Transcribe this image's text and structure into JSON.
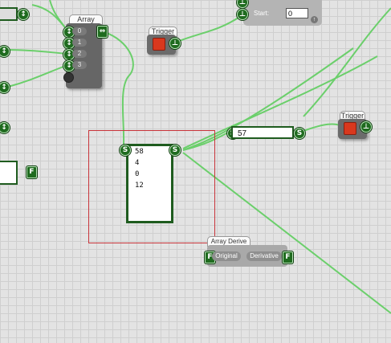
{
  "canvas": {
    "background": "#e3e3e3",
    "wire_color": "#6bcf6b",
    "port_color": "#1f6b1f"
  },
  "array_node": {
    "title": "Array",
    "indices": [
      "0",
      "1",
      "2",
      "3"
    ],
    "out_port_icon": "f-out-icon"
  },
  "trigger_nodes": [
    {
      "title": "Trigger"
    },
    {
      "title": "Trigger"
    }
  ],
  "start_node": {
    "label": "Start:",
    "value": "0"
  },
  "number_output": {
    "port_in": "S",
    "port_out": "S",
    "value": "57"
  },
  "list_display": {
    "port_in": "S",
    "port_out": "S",
    "items": [
      "58",
      "4",
      "0",
      "12"
    ]
  },
  "array_derive": {
    "title": "Array Derive",
    "in_label": "Original",
    "out_label": "Derivative",
    "port_glyph": "F"
  },
  "edge_nodes": {
    "left_box_port": "F"
  }
}
